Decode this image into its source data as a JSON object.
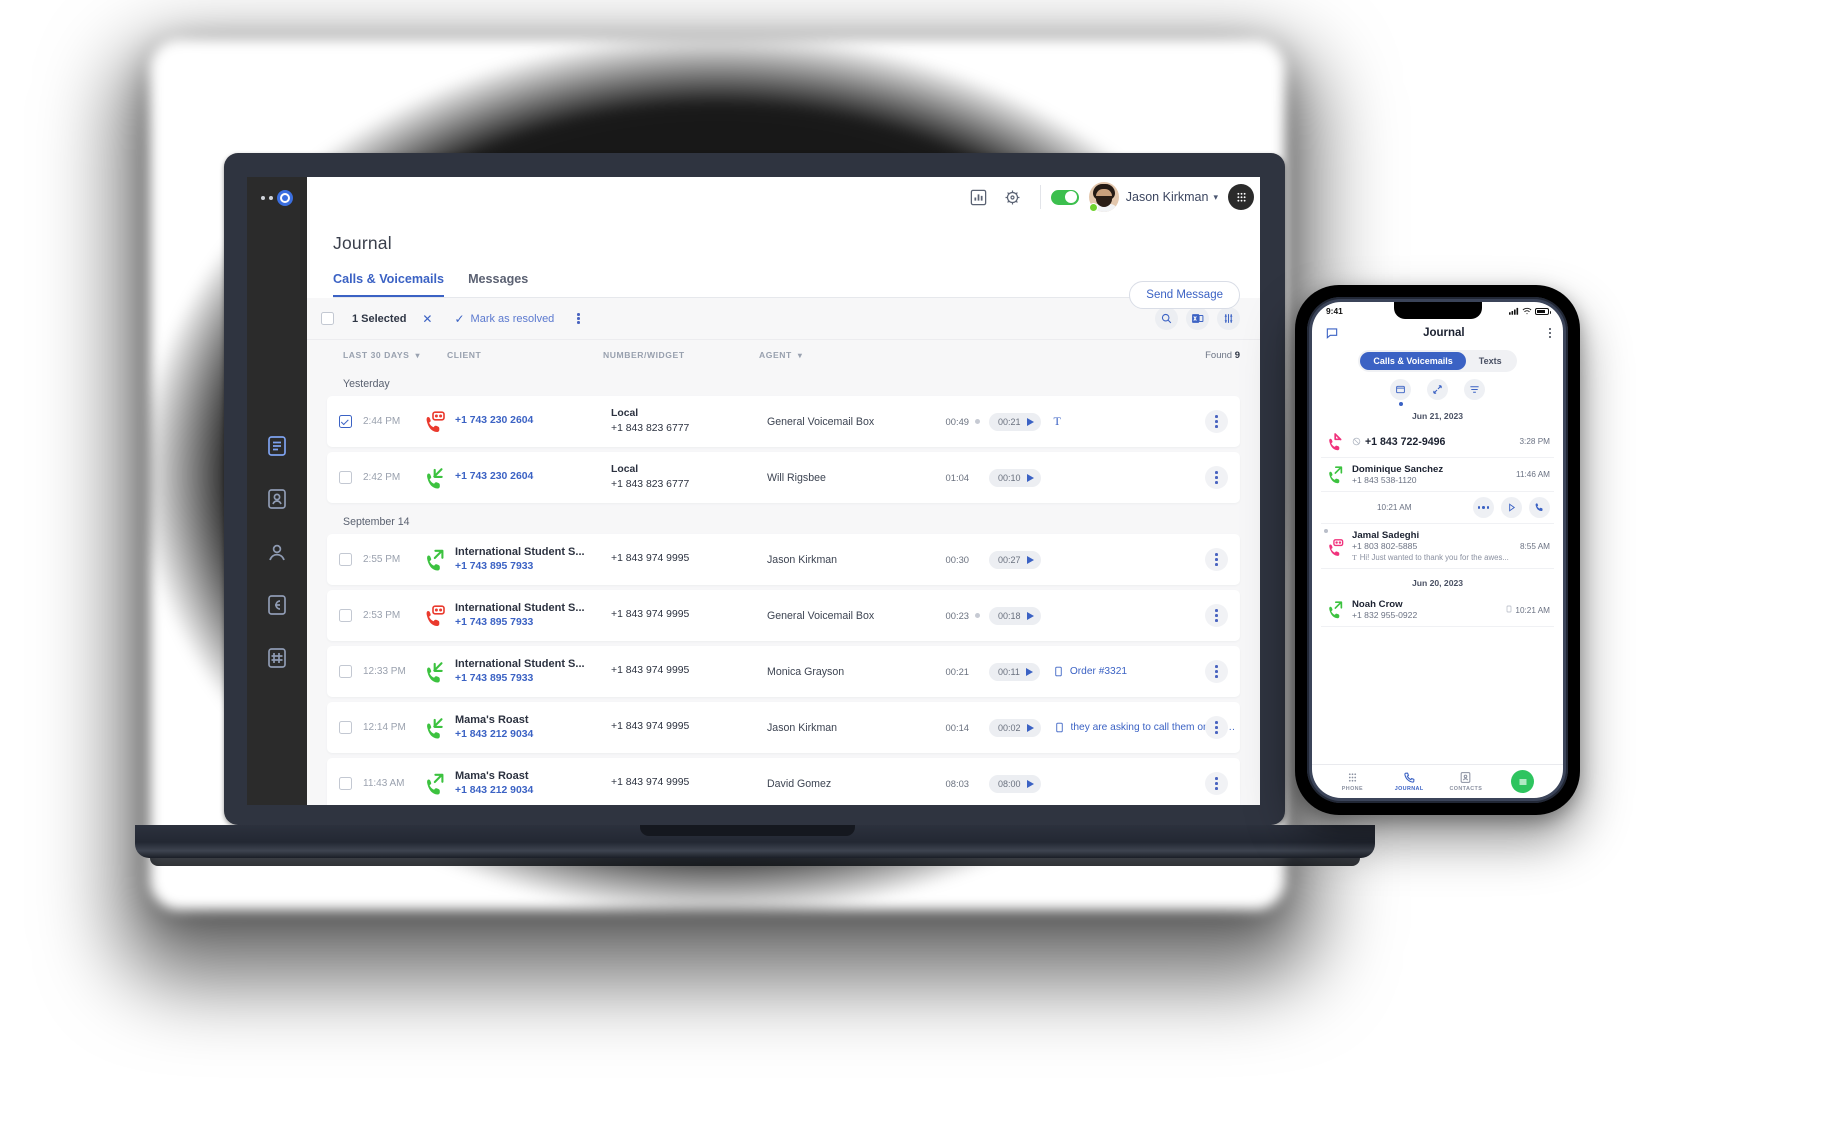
{
  "app": {
    "rail": {
      "logo": "logo-dots",
      "items": [
        {
          "name": "phone",
          "label": "Phone"
        },
        {
          "name": "contacts",
          "label": "Contacts"
        },
        {
          "name": "agents",
          "label": "Agents"
        },
        {
          "name": "integrations",
          "label": "Integrations"
        },
        {
          "name": "numbers",
          "label": "Numbers"
        }
      ]
    },
    "topbar": {
      "analytics_icon": "bar-chart-icon",
      "settings_icon": "gear-icon",
      "availability_toggle": "on",
      "user_name": "Jason Kirkman",
      "user_caret": "⌄",
      "status": "online",
      "dialpad_icon": "dialpad-icon"
    },
    "page": {
      "title": "Journal",
      "send_message_label": "Send Message"
    },
    "tabs": [
      {
        "label": "Calls & Voicemails",
        "active": true
      },
      {
        "label": "Messages",
        "active": false
      }
    ],
    "actionbar": {
      "selected_label": "1 Selected",
      "clear_icon": "close-icon",
      "resolve_label": "Mark as resolved",
      "resolve_icon": "check-icon",
      "more_icon": "kebab-icon",
      "search_icon": "search-icon",
      "export_icon": "excel-export-icon",
      "filter_icon": "filter-sliders-icon"
    },
    "columns": {
      "date": "LAST 30 DAYS",
      "client": "CLIENT",
      "number": "NUMBER/WIDGET",
      "agent": "AGENT",
      "found_label": "Found",
      "found_count": "9"
    },
    "groups": [
      {
        "day": "Yesterday",
        "rows": [
          {
            "selected": true,
            "time": "2:44 PM",
            "direction": "voicemail",
            "client_name": "",
            "client_number": "+1 743 230 2604",
            "number_label": "Local",
            "number_value": "+1 843 823 6777",
            "agent": "General Voicemail Box",
            "duration": "00:49",
            "unread": true,
            "play_time": "00:21",
            "transcript": "T",
            "note": ""
          },
          {
            "selected": false,
            "time": "2:42 PM",
            "direction": "incoming",
            "client_name": "",
            "client_number": "+1 743 230 2604",
            "number_label": "Local",
            "number_value": "+1 843 823 6777",
            "agent": "Will Rigsbee",
            "duration": "01:04",
            "unread": false,
            "play_time": "00:10",
            "transcript": "",
            "note": ""
          }
        ]
      },
      {
        "day": "September 14",
        "rows": [
          {
            "selected": false,
            "time": "2:55 PM",
            "direction": "outgoing",
            "client_name": "International Student S...",
            "client_number": "+1 743 895 7933",
            "number_label": "",
            "number_value": "+1 843 974 9995",
            "agent": "Jason Kirkman",
            "duration": "00:30",
            "unread": false,
            "play_time": "00:27",
            "transcript": "",
            "note": ""
          },
          {
            "selected": false,
            "time": "2:53 PM",
            "direction": "voicemail",
            "client_name": "International Student S...",
            "client_number": "+1 743 895 7933",
            "number_label": "",
            "number_value": "+1 843 974 9995",
            "agent": "General Voicemail Box",
            "duration": "00:23",
            "unread": true,
            "play_time": "00:18",
            "transcript": "",
            "note": ""
          },
          {
            "selected": false,
            "time": "12:33 PM",
            "direction": "incoming",
            "client_name": "International Student S...",
            "client_number": "+1 743 895 7933",
            "number_label": "",
            "number_value": "+1 843 974 9995",
            "agent": "Monica Grayson",
            "duration": "00:21",
            "unread": false,
            "play_time": "00:11",
            "transcript": "",
            "note": "Order #3321"
          },
          {
            "selected": false,
            "time": "12:14 PM",
            "direction": "incoming",
            "client_name": "Mama's Roast",
            "client_number": "+1 843 212 9034",
            "number_label": "",
            "number_value": "+1 843 974 9995",
            "agent": "Jason Kirkman",
            "duration": "00:14",
            "unread": false,
            "play_time": "00:02",
            "transcript": "",
            "note": "they are asking to call them once th..."
          },
          {
            "selected": false,
            "time": "11:43 AM",
            "direction": "outgoing",
            "client_name": "Mama's Roast",
            "client_number": "+1 843 212 9034",
            "number_label": "",
            "number_value": "+1 843 974 9995",
            "agent": "David Gomez",
            "duration": "08:03",
            "unread": false,
            "play_time": "08:00",
            "transcript": "",
            "note": ""
          }
        ]
      }
    ]
  },
  "phone": {
    "status": {
      "time": "9:41",
      "signal_icon": "cellular-icon",
      "wifi_icon": "wifi-icon",
      "battery_icon": "battery-icon"
    },
    "header": {
      "title": "Journal",
      "left_icon": "message-icon",
      "right_icon": "kebab-icon"
    },
    "segments": [
      {
        "label": "Calls & Voicemails",
        "active": true
      },
      {
        "label": "Texts",
        "active": false
      }
    ],
    "tools": [
      {
        "name": "inbox-icon",
        "selected": true
      },
      {
        "name": "arrows-icon",
        "selected": false
      },
      {
        "name": "filter-icon",
        "selected": false
      }
    ],
    "groups": [
      {
        "date": "Jun 21, 2023",
        "rows": [
          {
            "type": "missed",
            "name": "+1 843 722-9496",
            "number": "",
            "time": "3:28 PM",
            "note": "",
            "blocked": true
          },
          {
            "type": "outgoing",
            "name": "Dominique Sanchez",
            "number": "+1 843 538-1120",
            "time": "11:46 AM",
            "note": ""
          },
          {
            "type": "swipe",
            "name": "",
            "number": "",
            "time": "10:21 AM",
            "note": "",
            "actions": [
              "more-icon",
              "play-icon",
              "call-icon"
            ]
          },
          {
            "type": "voicemail",
            "name": "Jamal Sadeghi",
            "number": "+1 803 802-5885",
            "time": "8:55 AM",
            "note": "Hi! Just wanted to thank you for the awes...",
            "unread": true
          }
        ]
      },
      {
        "date": "Jun 20, 2023",
        "rows": [
          {
            "type": "outgoing",
            "name": "Noah Crow",
            "number": "+1 832 955-0922",
            "time": "10:21 AM",
            "note": "",
            "has_note_icon": true
          }
        ]
      }
    ],
    "tabbar": [
      {
        "label": "PHONE",
        "icon": "dialpad-icon",
        "active": false
      },
      {
        "label": "JOURNAL",
        "icon": "journal-icon",
        "active": true
      },
      {
        "label": "CONTACTS",
        "icon": "contacts-icon",
        "active": false
      },
      {
        "label": "",
        "icon": "menu-fab-icon",
        "active": false
      }
    ]
  }
}
